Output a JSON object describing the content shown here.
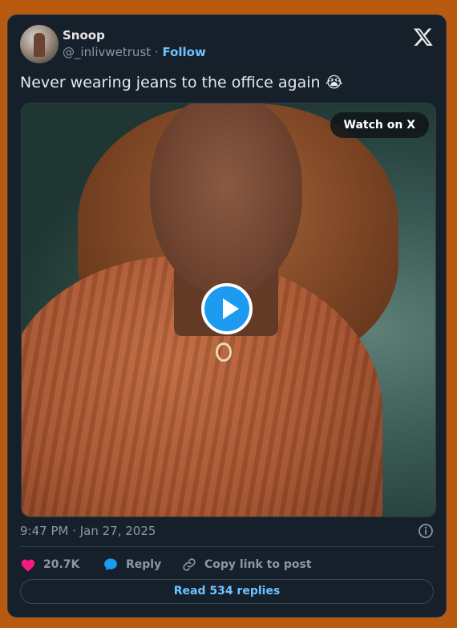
{
  "user": {
    "name": "Snoop",
    "handle": "@_inlivwetrust",
    "separator": " · ",
    "follow_label": "Follow"
  },
  "tweet": {
    "text": "Never wearing jeans to the office again 😭",
    "timestamp": "9:47 PM · Jan 27, 2025"
  },
  "media": {
    "watch_label": "Watch on X",
    "type": "video"
  },
  "actions": {
    "likes": "20.7K",
    "reply_label": "Reply",
    "copy_label": "Copy link to post"
  },
  "replies": {
    "label": "Read 534 replies"
  },
  "colors": {
    "accent": "#1d9bf0",
    "link": "#6ec3ff",
    "like": "#f91880",
    "card_bg": "#15202b",
    "page_bg": "#b85a10"
  },
  "icons": [
    "x-logo-icon",
    "play-icon",
    "info-icon",
    "heart-icon",
    "reply-icon",
    "link-icon"
  ]
}
